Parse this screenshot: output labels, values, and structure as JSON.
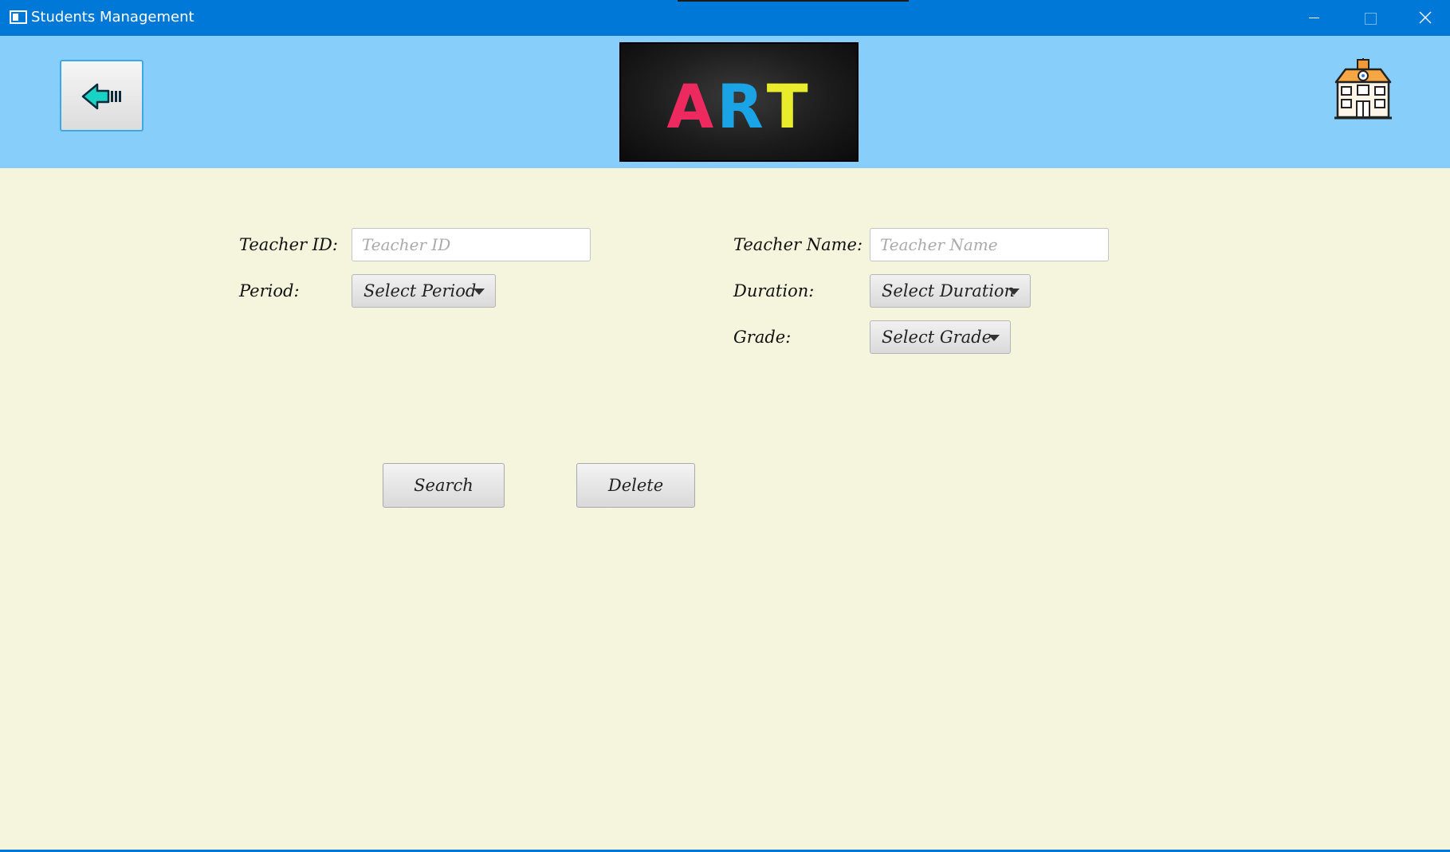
{
  "window": {
    "title": "Students Management",
    "icon": "window-app-icon",
    "controls": [
      "minimize-icon",
      "maximize-icon",
      "close-icon"
    ]
  },
  "header": {
    "back_icon": "back-arrow-icon",
    "banner_text": "ART",
    "banner_colors": [
      "#ec2a5f",
      "#1aa4e6",
      "#e8ec2a"
    ],
    "home_icon": "school-building-icon",
    "background": "#87cefa"
  },
  "form": {
    "teacher_id": {
      "label": "Teacher ID:",
      "placeholder": "Teacher ID",
      "value": ""
    },
    "teacher_name": {
      "label": "Teacher Name:",
      "placeholder": "Teacher Name",
      "value": ""
    },
    "period": {
      "label": "Period:",
      "selected": "Select Period"
    },
    "duration": {
      "label": "Duration:",
      "selected": "Select Duration"
    },
    "grade": {
      "label": "Grade:",
      "selected": "Select Grade"
    }
  },
  "actions": {
    "search_label": "Search",
    "delete_label": "Delete"
  },
  "colors": {
    "titlebar": "#0078d7",
    "page_background": "#f5f4dc"
  }
}
